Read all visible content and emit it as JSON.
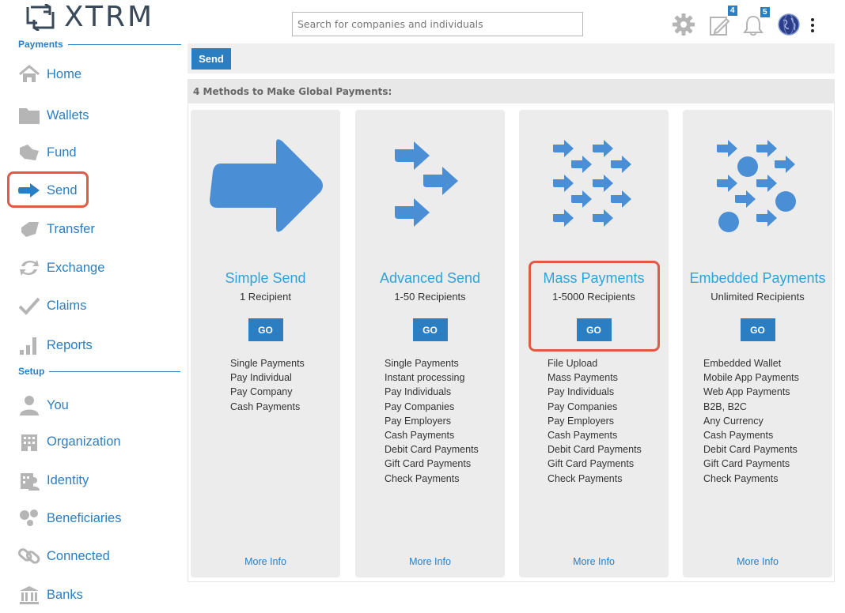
{
  "header": {
    "logo_text": "XTRM",
    "search_placeholder": "Search for companies and individuals",
    "icons": [
      "gear-icon",
      "edit-icon",
      "bell-icon",
      "globe-avatar",
      "more-vertical-icon"
    ],
    "edit_badge": "4",
    "bell_badge": "5"
  },
  "sidebar": {
    "payments_heading": "Payments",
    "setup_heading": "Setup",
    "items": [
      {
        "label": "Home",
        "icon": "home-icon"
      },
      {
        "label": "Wallets",
        "icon": "folder-icon"
      },
      {
        "label": "Fund",
        "icon": "fund-icon"
      },
      {
        "label": "Send",
        "icon": "send-arrow-icon"
      },
      {
        "label": "Transfer",
        "icon": "transfer-icon"
      },
      {
        "label": "Exchange",
        "icon": "exchange-icon"
      },
      {
        "label": "Claims",
        "icon": "check-icon"
      },
      {
        "label": "Reports",
        "icon": "bar-chart-icon"
      },
      {
        "label": "You",
        "icon": "user-icon"
      },
      {
        "label": "Organization",
        "icon": "building-icon"
      },
      {
        "label": "Identity",
        "icon": "identity-icon"
      },
      {
        "label": "Beneficiaries",
        "icon": "beneficiaries-icon"
      },
      {
        "label": "Connected",
        "icon": "link-icon"
      },
      {
        "label": "Banks",
        "icon": "bank-icon"
      }
    ]
  },
  "main": {
    "tab_label": "Send",
    "section_title": "4 Methods to Make Global Payments:",
    "cards": [
      {
        "title": "Simple Send",
        "subtitle": "1 Recipient",
        "go": "GO",
        "features": [
          "Single Payments",
          "Pay Individual",
          "Pay Company",
          "Cash Payments"
        ],
        "more": "More Info"
      },
      {
        "title": "Advanced Send",
        "subtitle": "1-50 Recipients",
        "go": "GO",
        "features": [
          "Single Payments",
          "Instant processing",
          "Pay Individuals",
          "Pay Companies",
          "Pay Employers",
          "Cash Payments",
          "Debit Card Payments",
          "Gift Card Payments",
          "Check Payments"
        ],
        "more": "More Info"
      },
      {
        "title": "Mass Payments",
        "subtitle": "1-5000 Recipients",
        "go": "GO",
        "features": [
          "File Upload",
          "Mass Payments",
          "Pay Individuals",
          "Pay Companies",
          "Pay Employers",
          "Cash Payments",
          "Debit Card Payments",
          "Gift Card Payments",
          "Check Payments"
        ],
        "more": "More Info"
      },
      {
        "title": "Embedded Payments",
        "subtitle": "Unlimited Recipients",
        "go": "GO",
        "features": [
          "Embedded Wallet",
          "Mobile App Payments",
          "Web App Payments",
          "B2B, B2C",
          "Any Currency",
          "Cash Payments",
          "Debit Card Payments",
          "Gift Card Payments",
          "Check Payments"
        ],
        "more": "More Info"
      }
    ]
  },
  "colors": {
    "accent": "#2b7ec1",
    "title_blue": "#2ea3d8",
    "highlight": "#e05a47",
    "icon_gray": "#b5b5b5"
  }
}
